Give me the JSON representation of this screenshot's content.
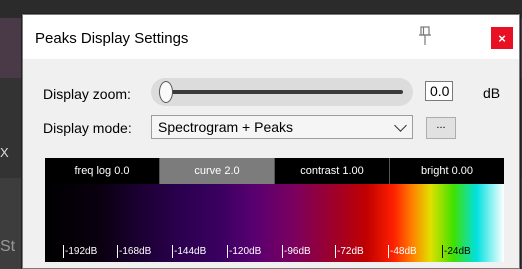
{
  "dialog": {
    "title": "Peaks Display Settings",
    "close_label": "×"
  },
  "zoom": {
    "label": "Display zoom:",
    "value": "0.0",
    "unit": "dB",
    "slider_position": 0.0
  },
  "mode": {
    "label": "Display mode:",
    "selected": "Spectrogram + Peaks",
    "more_button": "..."
  },
  "params": [
    {
      "label": "freq log 0.0"
    },
    {
      "label": "curve 2.0"
    },
    {
      "label": "contrast 1.00"
    },
    {
      "label": "bright 0.00"
    }
  ],
  "scale_ticks": [
    "-192dB",
    "-168dB",
    "-144dB",
    "-120dB",
    "-96dB",
    "-72dB",
    "-48dB",
    "-24dB"
  ],
  "background": {
    "left_marker": "X",
    "bottom_text": "St"
  },
  "colors": {
    "close_red": "#e81123",
    "active_param": "#7c7c7c"
  }
}
